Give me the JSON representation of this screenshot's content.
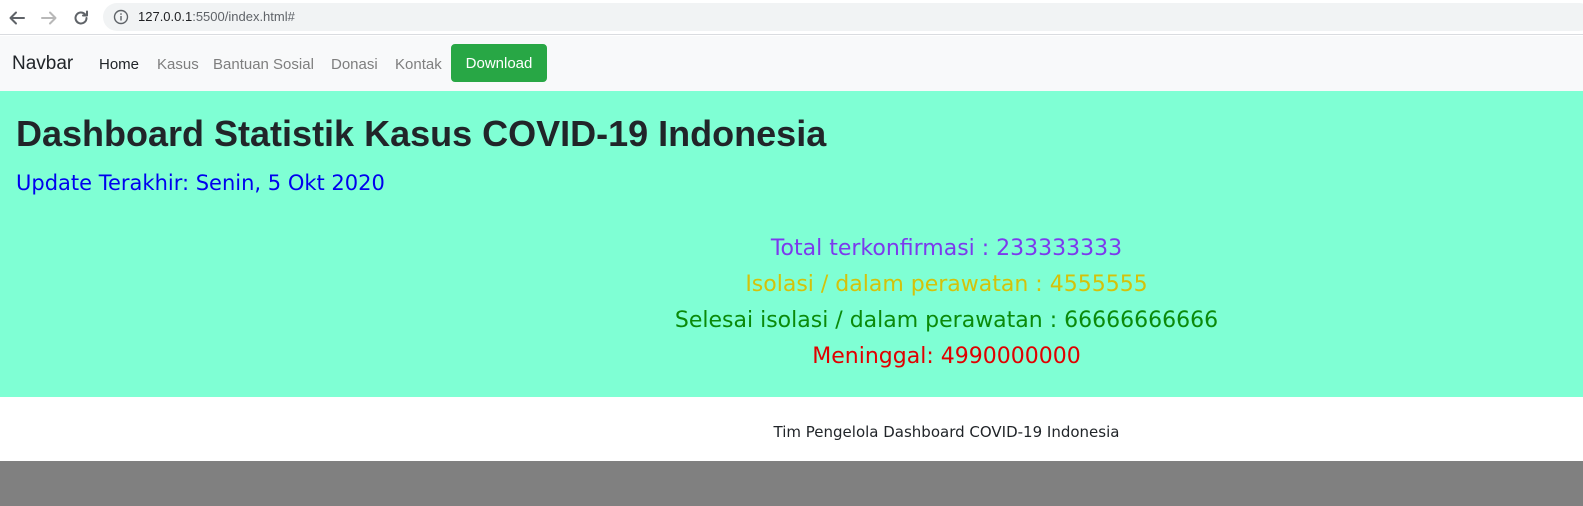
{
  "browser": {
    "url_host": "127.0.0.1",
    "url_rest": ":5500/index.html#"
  },
  "navbar": {
    "brand": "Navbar",
    "links": [
      {
        "label": "Home"
      },
      {
        "label": "Kasus"
      },
      {
        "label": "Bantuan Sosial"
      },
      {
        "label": "Donasi"
      },
      {
        "label": "Kontak"
      }
    ],
    "download_label": "Download"
  },
  "hero": {
    "title": "Dashboard Statistik Kasus COVID-19 Indonesia",
    "updated": "Update Terakhir: Senin, 5 Okt 2020"
  },
  "stats": [
    {
      "text": "Total terkonfirmasi : 233333333",
      "color": "#7c3aed"
    },
    {
      "text": "Isolasi / dalam perawatan : 4555555",
      "color": "#d4c20a"
    },
    {
      "text": "Selesai isolasi / dalam perawatan : 66666666666",
      "color": "#0a8a0a"
    },
    {
      "text": "Meninggal: 4990000000",
      "color": "#e00000"
    }
  ],
  "footer": {
    "text": "Tim Pengelola Dashboard COVID-19 Indonesia"
  },
  "colors": {
    "hero_bg": "#7fffd4",
    "updated_text": "#0000ee",
    "download_bg": "#28a745",
    "footer_bar": "#808080"
  }
}
